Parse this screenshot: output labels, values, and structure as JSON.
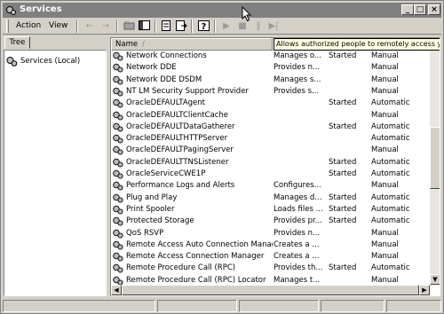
{
  "window": {
    "title": "Services"
  },
  "titlebar_buttons": {
    "minimize": "_",
    "maximize": "□",
    "close": "×"
  },
  "menu": {
    "action": "Action",
    "view": "View"
  },
  "toolbar": {
    "back": "←",
    "forward": "→",
    "start": "▶",
    "stop": "■",
    "pause": "‖",
    "restart": "▶|"
  },
  "tree": {
    "tab_label": "Tree",
    "root": "Services (Local)"
  },
  "columns": {
    "name": "Name",
    "sort_indicator": "/"
  },
  "tooltip": "Allows authorized people to remotely access your W",
  "services": [
    {
      "name": "Network Connections",
      "description": "Manages o...",
      "status": "Started",
      "startup": "Manual"
    },
    {
      "name": "Network DDE",
      "description": "Provides n...",
      "status": "",
      "startup": "Manual"
    },
    {
      "name": "Network DDE DSDM",
      "description": "Manages s...",
      "status": "",
      "startup": "Manual"
    },
    {
      "name": "NT LM Security Support Provider",
      "description": "Provides s...",
      "status": "",
      "startup": "Manual"
    },
    {
      "name": "OracleDEFAULTAgent",
      "description": "",
      "status": "Started",
      "startup": "Automatic"
    },
    {
      "name": "OracleDEFAULTClientCache",
      "description": "",
      "status": "",
      "startup": "Manual"
    },
    {
      "name": "OracleDEFAULTDataGatherer",
      "description": "",
      "status": "Started",
      "startup": "Automatic"
    },
    {
      "name": "OracleDEFAULTHTTPServer",
      "description": "",
      "status": "",
      "startup": "Automatic"
    },
    {
      "name": "OracleDEFAULTPagingServer",
      "description": "",
      "status": "",
      "startup": "Manual"
    },
    {
      "name": "OracleDEFAULTTNSListener",
      "description": "",
      "status": "Started",
      "startup": "Automatic"
    },
    {
      "name": "OracleServiceCWE1P",
      "description": "",
      "status": "Started",
      "startup": "Automatic"
    },
    {
      "name": "Performance Logs and Alerts",
      "description": "Configures...",
      "status": "",
      "startup": "Manual"
    },
    {
      "name": "Plug and Play",
      "description": "Manages d...",
      "status": "Started",
      "startup": "Automatic"
    },
    {
      "name": "Print Spooler",
      "description": "Loads files ...",
      "status": "Started",
      "startup": "Automatic"
    },
    {
      "name": "Protected Storage",
      "description": "Provides pr...",
      "status": "Started",
      "startup": "Automatic"
    },
    {
      "name": "QoS RSVP",
      "description": "Provides n...",
      "status": "",
      "startup": "Manual"
    },
    {
      "name": "Remote Access Auto Connection Manager",
      "description": "Creates a ...",
      "status": "",
      "startup": "Manual"
    },
    {
      "name": "Remote Access Connection Manager",
      "description": "Creates a ...",
      "status": "",
      "startup": "Manual"
    },
    {
      "name": "Remote Procedure Call (RPC)",
      "description": "Provides th...",
      "status": "Started",
      "startup": "Automatic"
    },
    {
      "name": "Remote Procedure Call (RPC) Locator",
      "description": "Manages t...",
      "status": "",
      "startup": "Manual"
    }
  ],
  "scrollbar": {
    "up": "▲",
    "down": "▼",
    "left": "◀",
    "right": "▶"
  }
}
